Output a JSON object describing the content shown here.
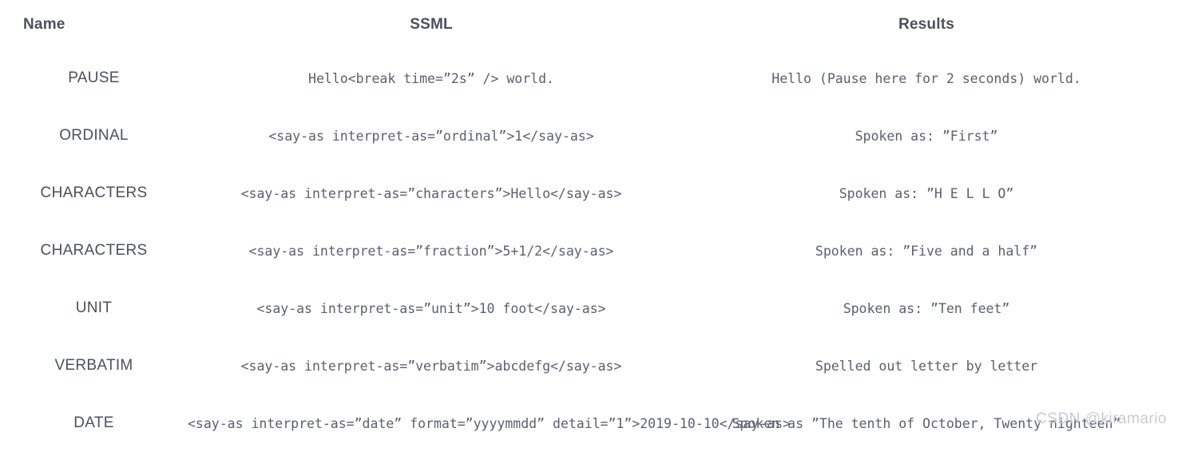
{
  "table": {
    "columns": [
      {
        "key": "name",
        "label": "Name"
      },
      {
        "key": "ssml",
        "label": "SSML"
      },
      {
        "key": "results",
        "label": "Results"
      }
    ],
    "rows": [
      {
        "name": "PAUSE",
        "ssml": "Hello<break time=”2s” /> world.",
        "results": "Hello (Pause here for 2 seconds) world."
      },
      {
        "name": "ORDINAL",
        "ssml": "<say-as interpret-as=”ordinal”>1</say-as>",
        "results": "Spoken as: ”First”"
      },
      {
        "name": "CHARACTERS",
        "ssml": "<say-as interpret-as=”characters”>Hello</say-as>",
        "results": "Spoken as: ”H E L L O”"
      },
      {
        "name": "CHARACTERS",
        "ssml": "<say-as interpret-as=”fraction”>5+1/2</say-as>",
        "results": "Spoken as: ”Five and a half”"
      },
      {
        "name": "UNIT",
        "ssml": "<say-as interpret-as=”unit”>10 foot</say-as>",
        "results": "Spoken as: ”Ten feet”"
      },
      {
        "name": "VERBATIM",
        "ssml": "<say-as interpret-as=”verbatim”>abcdefg</say-as>",
        "results": "Spelled out letter by letter"
      },
      {
        "name": "DATE",
        "ssml": "<say-as interpret-as=”date” format=”yyyymmdd” detail=”1”>2019-10-10</say-as>",
        "results": "Spoken as ”The tenth of October, Twenty nighteen”"
      }
    ]
  },
  "watermark": {
    "text": "CSDN @kiramario"
  },
  "colors": {
    "background": "#ffffff",
    "header_text": "#4a505e",
    "name_text": "#4a505e",
    "code_text": "#5a6070",
    "watermark_text": "#c9cbd0"
  }
}
